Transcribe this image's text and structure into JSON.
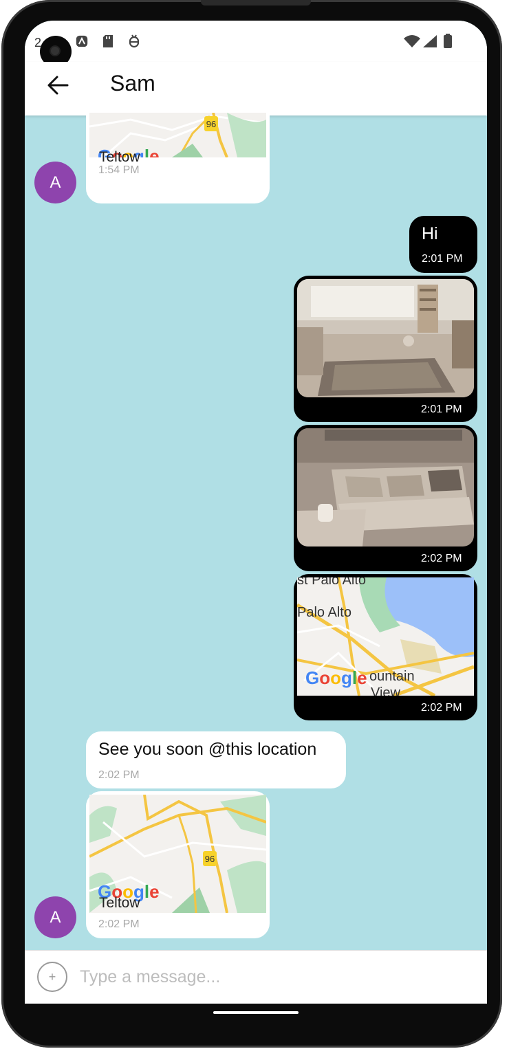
{
  "status_bar": {
    "clock_partial": "2",
    "icons": [
      "app-a-icon",
      "sd-card-icon",
      "debug-icon",
      "wifi-icon",
      "cell-signal-icon",
      "battery-icon"
    ]
  },
  "header": {
    "back_icon": "arrow-left-icon",
    "title": "Sam"
  },
  "colors": {
    "chat_background": "#b0dfe5",
    "incoming_bubble": "#ffffff",
    "outgoing_bubble": "#000000",
    "avatar": "#8e44ad"
  },
  "messages": [
    {
      "direction": "incoming",
      "type": "map",
      "map_label": "Teltow",
      "route_badge": "96",
      "map_logo": "Google",
      "time": "1:54 PM",
      "avatar_letter": "A"
    },
    {
      "direction": "outgoing",
      "type": "text",
      "text": "Hi",
      "time": "2:01 PM"
    },
    {
      "direction": "outgoing",
      "type": "image",
      "image": "living-room-photo",
      "time": "2:01 PM"
    },
    {
      "direction": "outgoing",
      "type": "image",
      "image": "sofa-photo",
      "time": "2:02 PM"
    },
    {
      "direction": "outgoing",
      "type": "map",
      "map_labels": [
        "st Palo Alto",
        "Palo Alto",
        "ountain",
        "View"
      ],
      "map_logo": "Google",
      "time": "2:02 PM"
    },
    {
      "direction": "incoming",
      "type": "text",
      "text": "See you soon @this location",
      "time": "2:02 PM"
    },
    {
      "direction": "incoming",
      "type": "map",
      "map_label": "Teltow",
      "route_badge": "96",
      "map_logo": "Google",
      "time": "2:02 PM",
      "avatar_letter": "A"
    }
  ],
  "composer": {
    "plus_icon": "plus-circle-icon",
    "placeholder": "Type a message..."
  }
}
